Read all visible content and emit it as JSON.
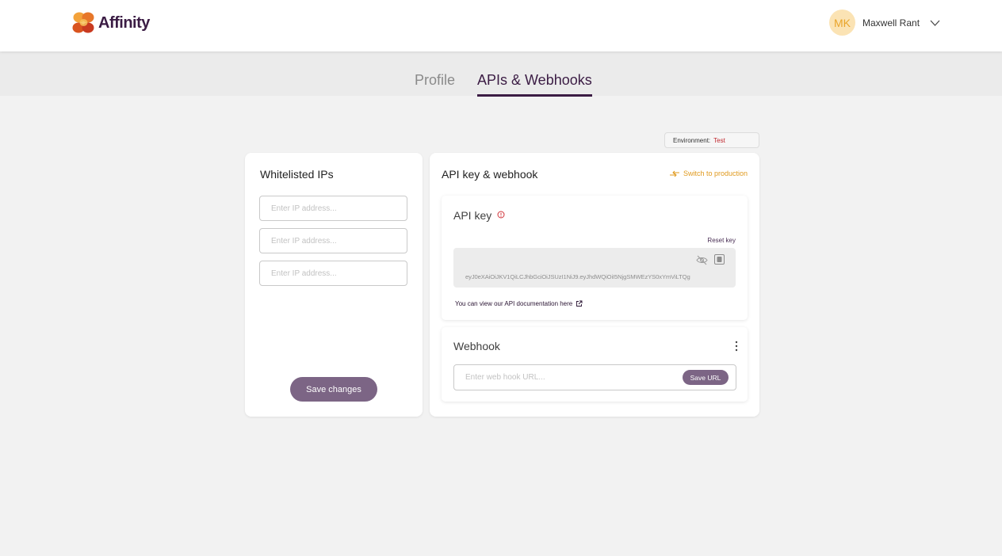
{
  "header": {
    "brand": "Affinity",
    "user": {
      "initials": "MK",
      "name": "Maxwell Rant"
    }
  },
  "tabs": [
    {
      "label": "Profile",
      "active": false
    },
    {
      "label": "APIs & Webhooks",
      "active": true
    }
  ],
  "environment": {
    "label": "Environment:",
    "value": "Test"
  },
  "whitelist": {
    "title": "Whitelisted IPs",
    "inputs": [
      {
        "placeholder": "Enter IP address...",
        "value": ""
      },
      {
        "placeholder": "Enter IP address...",
        "value": ""
      },
      {
        "placeholder": "Enter IP address...",
        "value": ""
      }
    ],
    "save_label": "Save changes"
  },
  "api_webhook": {
    "title": "API key & webhook",
    "switch_label": "Switch to production",
    "api_key": {
      "title": "API key",
      "reset_label": "Reset key",
      "key": "eyJ0eXAiOiJKV1QiLCJhbGciOiJSUzI1NiJ9.eyJhdWQiOiI5NjgSMWEzYS0xYmViLTQg",
      "doc_text": "You can view our API documentation here"
    },
    "webhook": {
      "title": "Webhook",
      "placeholder": "Enter web hook URL...",
      "value": "",
      "save_label": "Save URL"
    }
  },
  "colors": {
    "brand_purple": "#3b1c44",
    "button_purple": "#7c6585",
    "accent_orange": "#e09a1e",
    "env_red": "#c0282f",
    "avatar_bg": "#fbe3b4"
  },
  "icons": [
    "affinity-logo",
    "chevron-down-icon",
    "switch-arrows-icon",
    "info-icon",
    "eye-off-icon",
    "copy-icon",
    "external-link-icon",
    "kebab-menu-icon"
  ]
}
